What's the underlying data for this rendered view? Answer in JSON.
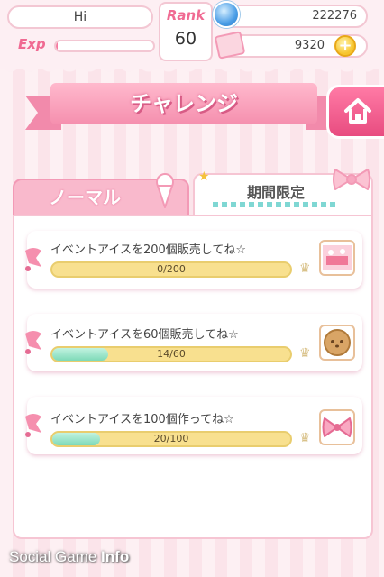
{
  "header": {
    "player_name": "Hi",
    "exp_label": "Exp",
    "exp_progress": 0.02,
    "rank_label": "Rank",
    "rank_value": "60",
    "coins": "222276",
    "tickets": "9320",
    "plus_label": "+"
  },
  "title": "チャレンジ",
  "tabs": [
    {
      "label": "ノーマル",
      "active": false
    },
    {
      "label": "期間限定",
      "active": true
    }
  ],
  "challenges": [
    {
      "title": "イベントアイスを200個販売してね☆",
      "progress_text": "0/200",
      "progress": 0.0,
      "reward_icon": "tray-scene-icon"
    },
    {
      "title": "イベントアイスを60個販売してね☆",
      "progress_text": "14/60",
      "progress": 0.233,
      "reward_icon": "cookie-icon"
    },
    {
      "title": "イベントアイスを100個作ってね☆",
      "progress_text": "20/100",
      "progress": 0.2,
      "reward_icon": "bow-icon"
    }
  ],
  "watermark": {
    "part1": "Social Game ",
    "part2": "Info"
  },
  "colors": {
    "accent_pink": "#f06a92",
    "bar_yellow": "#f8e08f",
    "bar_mint": "#7ed9b8"
  }
}
